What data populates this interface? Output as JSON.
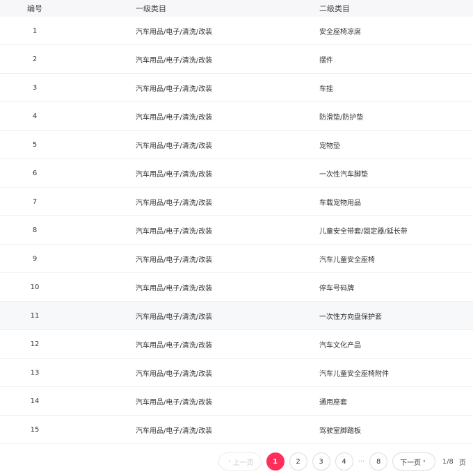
{
  "table": {
    "headers": [
      "编号",
      "一级类目",
      "二级类目"
    ],
    "rows": [
      {
        "id": "1",
        "cat1": "汽车用品/电子/清洗/改装",
        "cat2": "安全座椅凉席"
      },
      {
        "id": "2",
        "cat1": "汽车用品/电子/清洗/改装",
        "cat2": "摆件"
      },
      {
        "id": "3",
        "cat1": "汽车用品/电子/清洗/改装",
        "cat2": "车挂"
      },
      {
        "id": "4",
        "cat1": "汽车用品/电子/清洗/改装",
        "cat2": "防滑垫/防护垫"
      },
      {
        "id": "5",
        "cat1": "汽车用品/电子/清洗/改装",
        "cat2": "宠物垫"
      },
      {
        "id": "6",
        "cat1": "汽车用品/电子/清洗/改装",
        "cat2": "一次性汽车脚垫"
      },
      {
        "id": "7",
        "cat1": "汽车用品/电子/清洗/改装",
        "cat2": "车载宠物用品"
      },
      {
        "id": "8",
        "cat1": "汽车用品/电子/清洗/改装",
        "cat2": "儿童安全带套/固定器/延长带"
      },
      {
        "id": "9",
        "cat1": "汽车用品/电子/清洗/改装",
        "cat2": "汽车儿童安全座椅"
      },
      {
        "id": "10",
        "cat1": "汽车用品/电子/清洗/改装",
        "cat2": "停车号码牌"
      },
      {
        "id": "11",
        "cat1": "汽车用品/电子/清洗/改装",
        "cat2": "一次性方向盘保护套"
      },
      {
        "id": "12",
        "cat1": "汽车用品/电子/清洗/改装",
        "cat2": "汽车文化产品"
      },
      {
        "id": "13",
        "cat1": "汽车用品/电子/清洗/改装",
        "cat2": "汽车儿童安全座椅附件"
      },
      {
        "id": "14",
        "cat1": "汽车用品/电子/清洗/改装",
        "cat2": "通用座套"
      },
      {
        "id": "15",
        "cat1": "汽车用品/电子/清洗/改装",
        "cat2": "驾驶室脚踏板"
      }
    ],
    "highlighted_row": "11"
  },
  "pagination": {
    "prev_label": "上一页",
    "next_label": "下一页",
    "pages": [
      "1",
      "2",
      "3",
      "4"
    ],
    "ellipsis": "···",
    "last_page": "8",
    "current_page": "1",
    "page_info": "1/8",
    "tail_text": "页",
    "accent_color": "#ff2e5b"
  }
}
